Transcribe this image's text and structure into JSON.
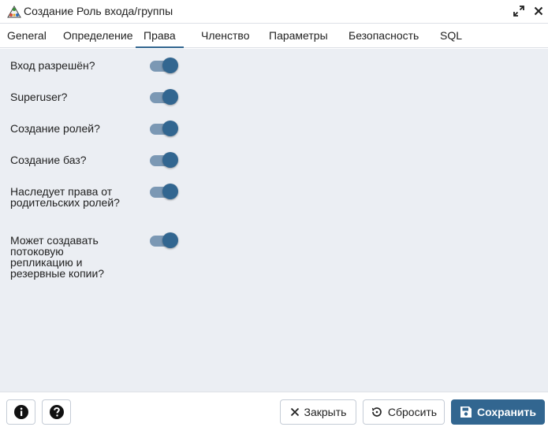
{
  "window": {
    "title": "Создание Роль входа/группы",
    "icons": {
      "app": "pgadmin-role-icon",
      "expand": "expand-icon",
      "close": "close-icon"
    }
  },
  "tabs": [
    {
      "label": "General",
      "active": false
    },
    {
      "label": "Определение",
      "active": false
    },
    {
      "label": "Права",
      "active": true
    },
    {
      "label": "Членство",
      "active": false
    },
    {
      "label": "Параметры",
      "active": false
    },
    {
      "label": "Безопасность",
      "active": false
    },
    {
      "label": "SQL",
      "active": false
    }
  ],
  "privileges": [
    {
      "label": "Вход разрешён?",
      "value": true
    },
    {
      "label": "Superuser?",
      "value": true
    },
    {
      "label": "Создание ролей?",
      "value": true
    },
    {
      "label": "Создание баз?",
      "value": true
    },
    {
      "label": "Наследует права от родительских ролей?",
      "value": true
    },
    {
      "label": "Может создавать потоковую репликацию и резервные копии?",
      "value": true
    }
  ],
  "footer": {
    "info_icon": "info-icon",
    "help_icon": "help-icon",
    "close_label": "Закрыть",
    "reset_label": "Сбросить",
    "save_label": "Сохранить"
  },
  "colors": {
    "accent": "#326690",
    "switch_track": "#7b98b4",
    "content_bg": "#ebeef3"
  }
}
